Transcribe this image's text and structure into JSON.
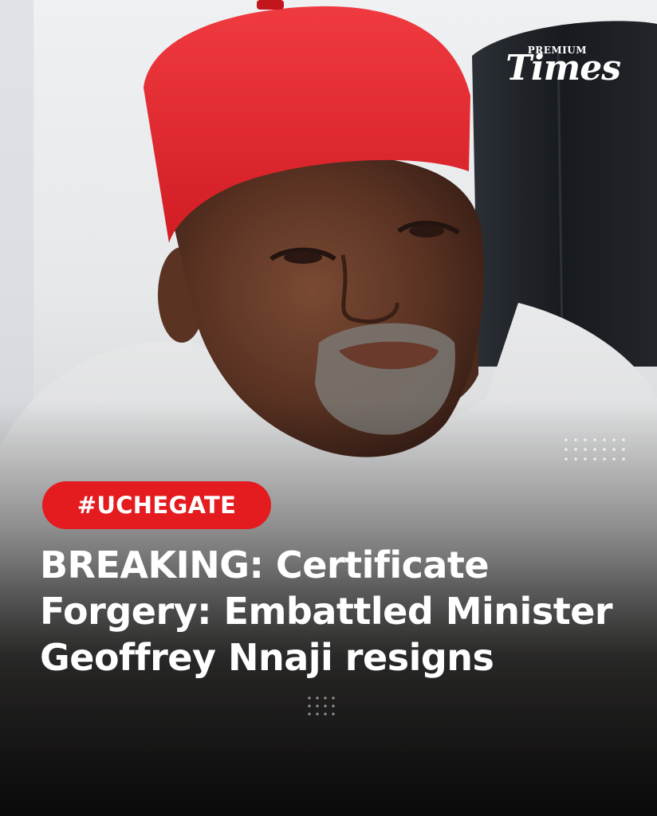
{
  "brand": {
    "kicker": "PREMIUM",
    "wordmark": "Times"
  },
  "tag": {
    "label": "#UCHEGATE",
    "color": "#e41b1f"
  },
  "headline": {
    "text": "BREAKING: Certificate Forgery: Embattled Minister Geoffrey Nnaji resigns"
  },
  "photo": {
    "cap_color": "#e2262d",
    "garment_color": "#dfe0e1",
    "chair_color": "#1d2126"
  },
  "icons": [
    "dot-grid-icon"
  ]
}
